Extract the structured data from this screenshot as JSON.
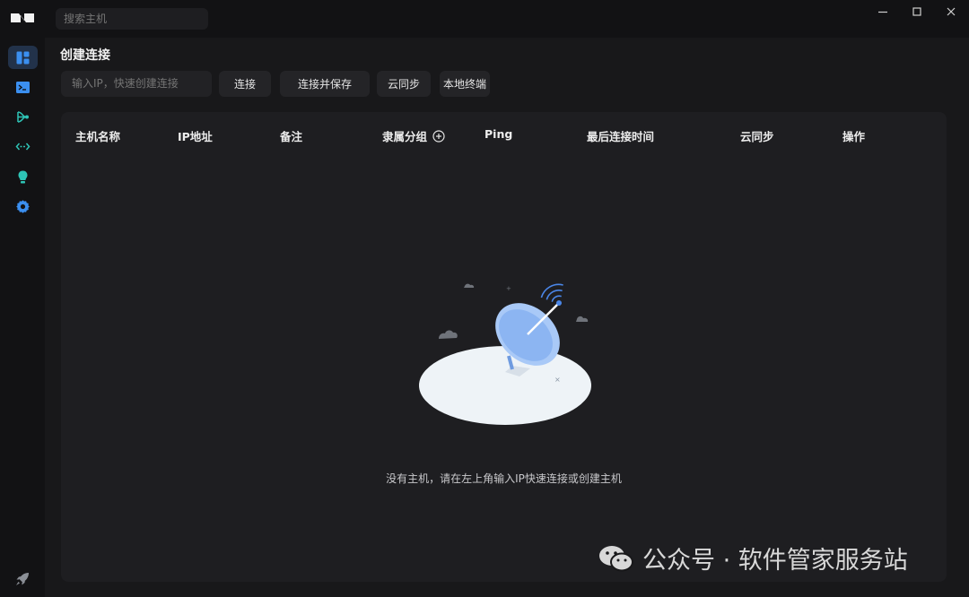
{
  "topbar": {
    "search_placeholder": "搜索主机"
  },
  "window_controls": [
    "minimize-icon",
    "maximize-icon",
    "close-icon"
  ],
  "sidebar": {
    "items": [
      {
        "icon": "dashboard-icon",
        "active": true
      },
      {
        "icon": "terminal-icon",
        "active": false
      },
      {
        "icon": "topology-icon",
        "active": false
      },
      {
        "icon": "port-forward-icon",
        "active": false
      },
      {
        "icon": "lightbulb-icon",
        "active": false
      },
      {
        "icon": "gear-icon",
        "active": false
      }
    ],
    "bottom_icon": "rocket-icon"
  },
  "main": {
    "title": "创建连接",
    "ip_placeholder": "输入IP，快速创建连接",
    "buttons": {
      "connect": "连接",
      "connect_save": "连接并保存",
      "cloud_sync": "云同步",
      "local_terminal": "本地终端"
    },
    "table": {
      "columns": [
        "主机名称",
        "IP地址",
        "备注",
        "隶属分组",
        "Ping",
        "最后连接时间",
        "云同步",
        "操作"
      ],
      "rows": []
    },
    "empty_text": "没有主机，请在左上角输入IP快速连接或创建主机"
  },
  "watermark": "公众号 · 软件管家服务站",
  "colors": {
    "accent_blue": "#3b8ff0",
    "accent_teal": "#2ec4b6",
    "background": "#121214",
    "panel": "#1e1e21"
  }
}
